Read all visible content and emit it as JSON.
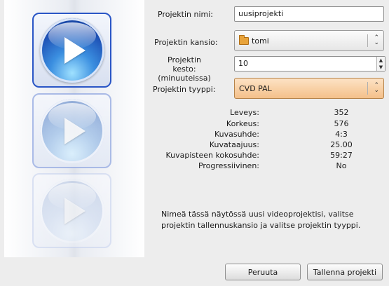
{
  "form": {
    "name_label": "Projektin nimi:",
    "name_value": "uusiprojekti",
    "folder_label": "Projektin kansio:",
    "folder_value": "tomi",
    "duration_label_line1": "Projektin kesto:",
    "duration_label_line2": "(minuuteissa)",
    "duration_value": "10",
    "type_label": "Projektin tyyppi:",
    "type_value": "CVD PAL"
  },
  "info": [
    {
      "label": "Leveys:",
      "value": "352"
    },
    {
      "label": "Korkeus:",
      "value": "576"
    },
    {
      "label": "Kuvasuhde:",
      "value": "4:3"
    },
    {
      "label": "Kuvataajuus:",
      "value": "25.00"
    },
    {
      "label": "Kuvapisteen kokosuhde:",
      "value": "59:27"
    },
    {
      "label": "Progressiivinen:",
      "value": "No"
    }
  ],
  "help_text": "Nimeä tässä näytössä uusi videoprojektisi, valitse projektin tallennuskansio ja valitse projektin tyyppi.",
  "buttons": {
    "cancel": "Peruuta",
    "save": "Tallenna projekti"
  },
  "icons": {
    "play": "play-icon",
    "folder": "folder-icon",
    "combo_arrows": "up-down-arrows-icon",
    "spin_arrows": "spin-arrows-icon"
  },
  "colors": {
    "accent": "#2a56c6",
    "active_combo": "#f4c08a"
  }
}
